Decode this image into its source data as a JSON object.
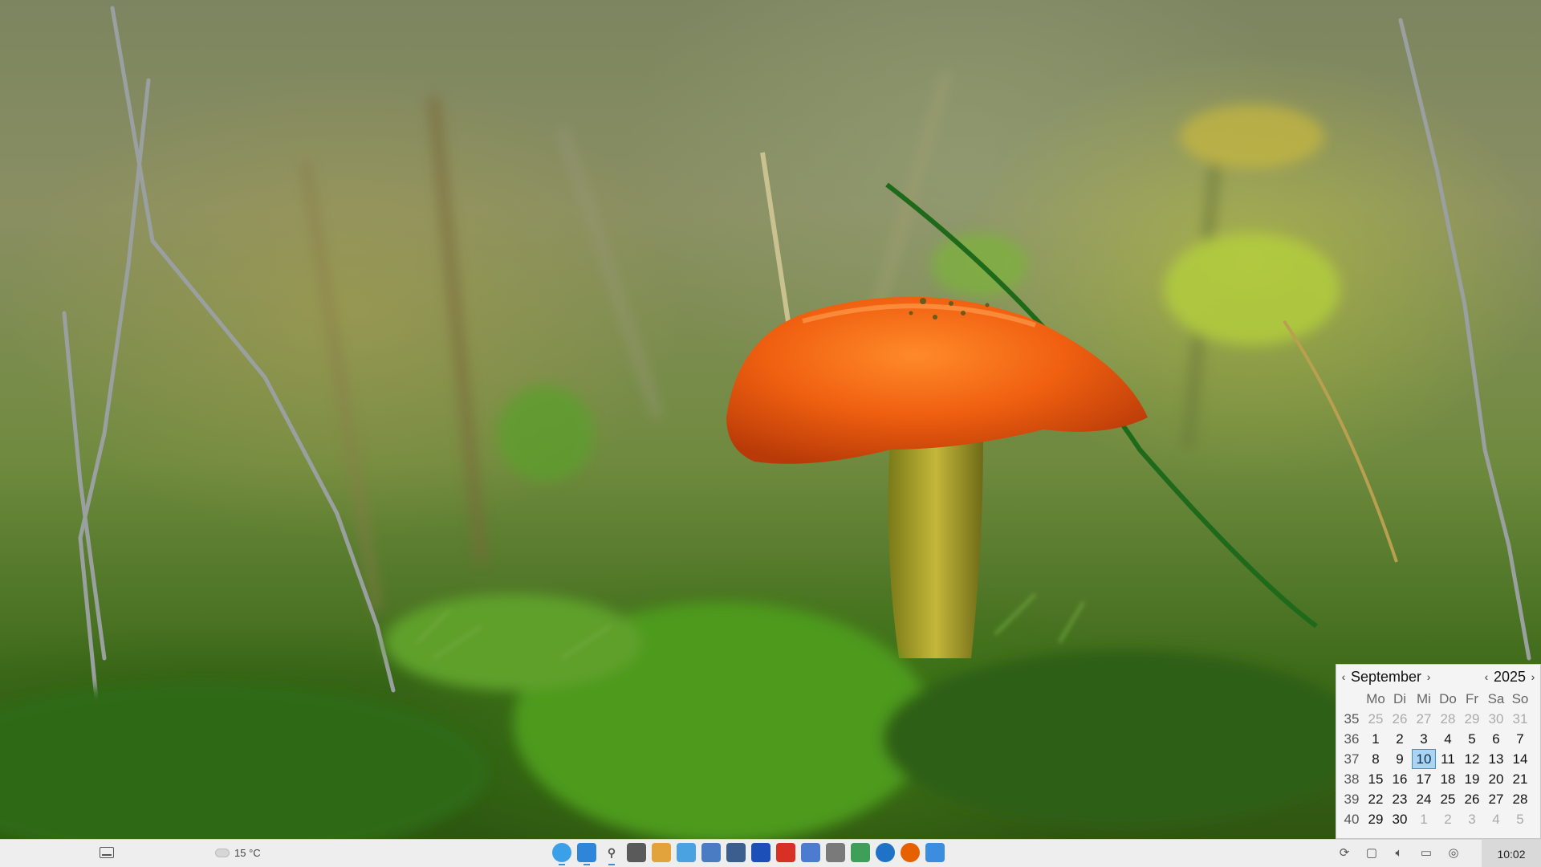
{
  "taskbar": {
    "weather_temp": "15 °C",
    "clock": "10:02",
    "apps": [
      {
        "name": "start-menu-icon",
        "color": "#3aa0e8"
      },
      {
        "name": "file-manager-icon",
        "color": "#2f86d8"
      },
      {
        "name": "search-icon",
        "color": "#666666"
      },
      {
        "name": "terminal-icon",
        "color": "#5a5a5a"
      },
      {
        "name": "files-icon",
        "color": "#e2a23c"
      },
      {
        "name": "phone-icon",
        "color": "#4aa3e0"
      },
      {
        "name": "screenshot-icon",
        "color": "#4a7cc4"
      },
      {
        "name": "remote-desktop-icon",
        "color": "#3b5e8e"
      },
      {
        "name": "utility-icon",
        "color": "#1d4fb8"
      },
      {
        "name": "gmail-icon",
        "color": "#d93025"
      },
      {
        "name": "document-viewer-icon",
        "color": "#4c7bd0"
      },
      {
        "name": "notes-icon",
        "color": "#7a7a7a"
      },
      {
        "name": "layers-icon",
        "color": "#3e9f5a"
      },
      {
        "name": "thunderbird-icon",
        "color": "#1f73c7"
      },
      {
        "name": "firefox-icon",
        "color": "#e66000"
      },
      {
        "name": "editor-icon",
        "color": "#3b8de0"
      }
    ]
  },
  "calendar": {
    "month": "September",
    "year": "2025",
    "day_names": [
      "Mo",
      "Di",
      "Mi",
      "Do",
      "Fr",
      "Sa",
      "So"
    ],
    "weeks": [
      {
        "week": "35",
        "days": [
          "25",
          "26",
          "27",
          "28",
          "29",
          "30",
          "31"
        ],
        "muted": [
          true,
          true,
          true,
          true,
          true,
          true,
          true
        ]
      },
      {
        "week": "36",
        "days": [
          "1",
          "2",
          "3",
          "4",
          "5",
          "6",
          "7"
        ],
        "muted": [
          false,
          false,
          false,
          false,
          false,
          false,
          false
        ]
      },
      {
        "week": "37",
        "days": [
          "8",
          "9",
          "10",
          "11",
          "12",
          "13",
          "14"
        ],
        "muted": [
          false,
          false,
          false,
          false,
          false,
          false,
          false
        ]
      },
      {
        "week": "38",
        "days": [
          "15",
          "16",
          "17",
          "18",
          "19",
          "20",
          "21"
        ],
        "muted": [
          false,
          false,
          false,
          false,
          false,
          false,
          false
        ]
      },
      {
        "week": "39",
        "days": [
          "22",
          "23",
          "24",
          "25",
          "26",
          "27",
          "28"
        ],
        "muted": [
          false,
          false,
          false,
          false,
          false,
          false,
          false
        ]
      },
      {
        "week": "40",
        "days": [
          "29",
          "30",
          "1",
          "2",
          "3",
          "4",
          "5"
        ],
        "muted": [
          false,
          false,
          true,
          true,
          true,
          true,
          true
        ]
      }
    ],
    "today": "10",
    "prev_glyph": "‹",
    "next_glyph": "›"
  }
}
